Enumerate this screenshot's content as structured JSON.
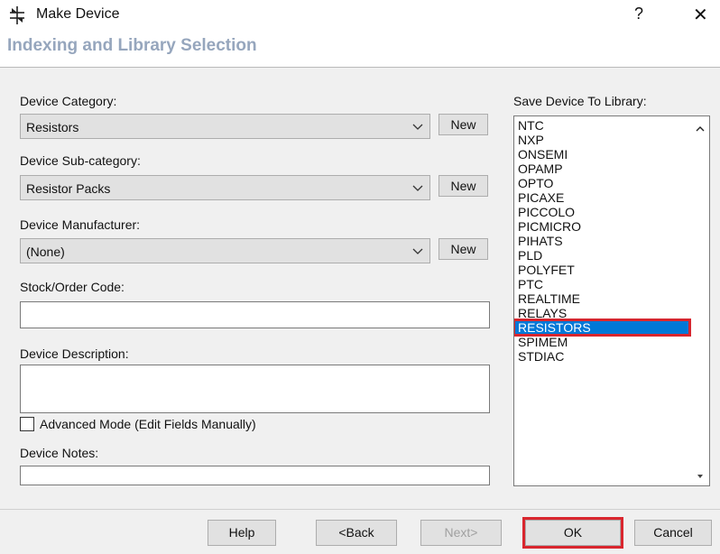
{
  "window": {
    "title": "Make Device",
    "help_symbol": "?",
    "close_symbol": "✕"
  },
  "header": {
    "title": "Indexing and Library Selection"
  },
  "form": {
    "category_label": "Device Category:",
    "category_value": "Resistors",
    "subcategory_label": "Device Sub-category:",
    "subcategory_value": "Resistor Packs",
    "manufacturer_label": "Device Manufacturer:",
    "manufacturer_value": "(None)",
    "new_label": "New",
    "stock_label": "Stock/Order Code:",
    "stock_value": "",
    "description_label": "Device Description:",
    "description_value": "",
    "advanced_label": "Advanced Mode (Edit Fields Manually)",
    "advanced_checked": false,
    "notes_label": "Device Notes:",
    "notes_value": ""
  },
  "library": {
    "label": "Save Device To Library:",
    "items": [
      "NTC",
      "NXP",
      "ONSEMI",
      "OPAMP",
      "OPTO",
      "PICAXE",
      "PICCOLO",
      "PICMICRO",
      "PIHATS",
      "PLD",
      "POLYFET",
      "PTC",
      "REALTIME",
      "RELAYS",
      "RESISTORS",
      "SPIMEM",
      "STDIAC"
    ],
    "selected": "RESISTORS"
  },
  "footer": {
    "help_label": "Help",
    "back_label": "<Back",
    "next_label": "Next>",
    "ok_label": "OK",
    "cancel_label": "Cancel"
  },
  "colors": {
    "header_title": "#96a6bd",
    "selection": "#0078d7",
    "highlight_outline": "#d9262e"
  }
}
